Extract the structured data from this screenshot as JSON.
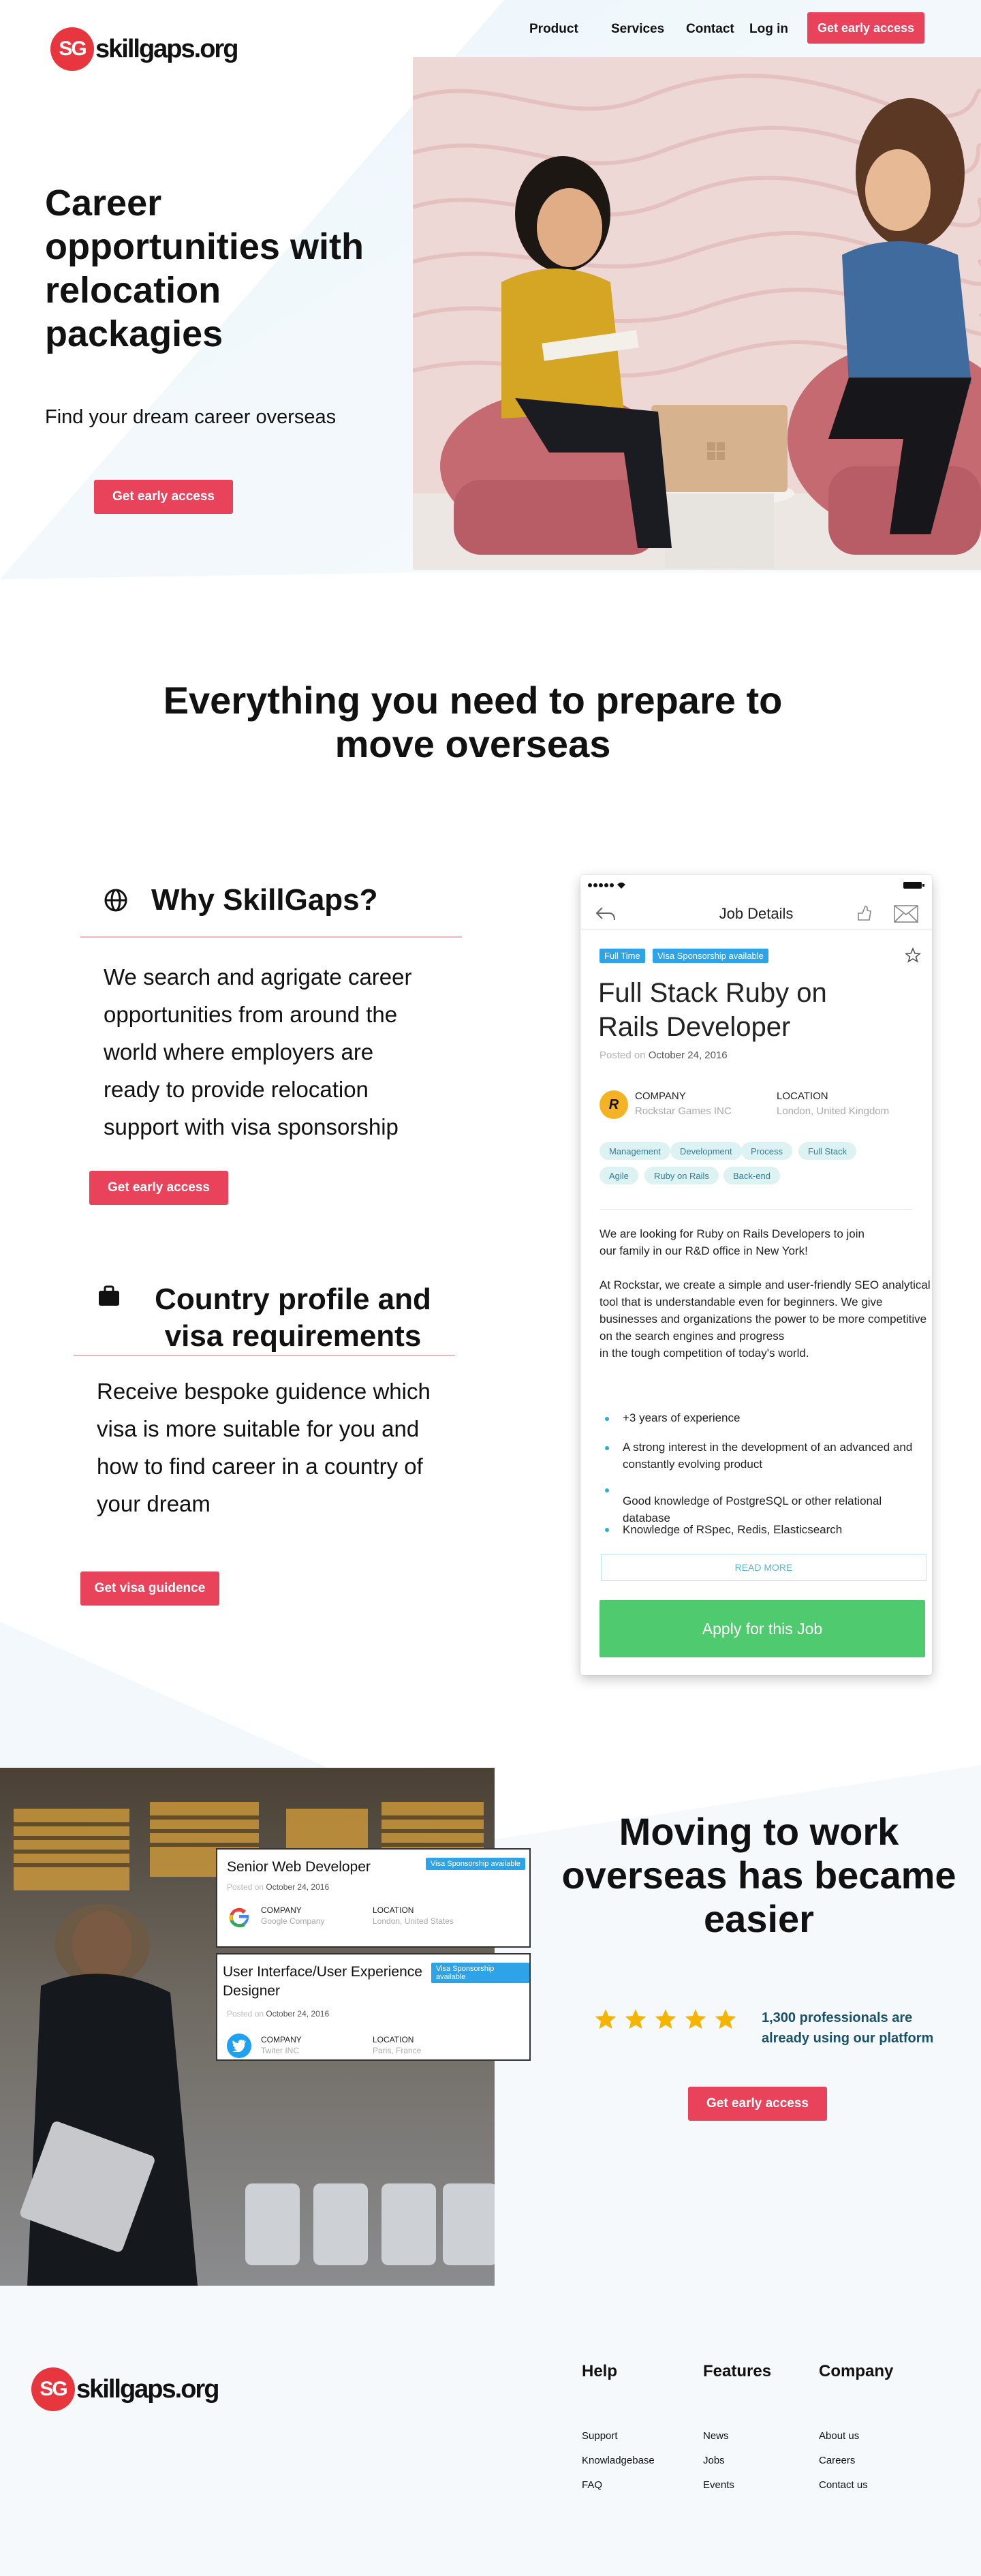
{
  "brand": {
    "badge": "SG",
    "name": "skillgaps.org"
  },
  "nav": {
    "product": "Product",
    "services": "Services",
    "contact": "Contact",
    "login": "Log in",
    "cta": "Get early access"
  },
  "hero": {
    "title_line1": "Career",
    "title_line2": "opportunities with",
    "title_line3": "relocation",
    "title_line4": "packagies",
    "subtitle": "Find your dream career overseas",
    "cta": "Get early access"
  },
  "features": {
    "title_line1": "Everything you need to prepare to",
    "title_line2": "move overseas",
    "why": {
      "icon": "globe-icon",
      "heading": "Why SkillGaps?",
      "body_lines": [
        "We search and agrigate career",
        "opportunities from around the",
        "world where employers are",
        "ready to provide relocation",
        "support with visa sponsorship"
      ],
      "cta": "Get early access"
    },
    "country": {
      "icon": "briefcase-icon",
      "heading_line1": "Country profile and",
      "heading_line2": "visa requirements",
      "body_lines": [
        "Receive bespoke guidence which",
        "visa is more suitable for you and",
        "how to find career in a country of",
        "your dream"
      ],
      "cta": "Get visa guidence"
    }
  },
  "job_details": {
    "screen_title": "Job Details",
    "tags": [
      "Full Time",
      "Visa Sponsorship available"
    ],
    "title_line1": "Full Stack Ruby on",
    "title_line2": "Rails Developer",
    "posted_label": "Posted on",
    "posted_date": "October 24, 2016",
    "company_label": "COMPANY",
    "company_value": "Rockstar Games INC",
    "location_label": "LOCATION",
    "location_value": "London, United Kingdom",
    "skills_row1": [
      "Management",
      "Development",
      "Process",
      "Full Stack"
    ],
    "skills_row2": [
      "Agile",
      "Ruby on Rails",
      "Back-end"
    ],
    "desc_lines": [
      "We are looking for Ruby on Rails Developers to join",
      "our family in our R&D office in New York!",
      "",
      "At Rockstar, we create a simple and user-friendly SEO analytical",
      "tool that is understandable even for beginners. We give",
      "businesses and organizations the power to be more competitive",
      "on the search engines and progress",
      "in the tough competition of today's world."
    ],
    "requirements": [
      "+3 years of experience",
      "A strong interest in the development of an advanced and",
      "constantly evolving product",
      "Good knowledge of PostgreSQL or other relational database",
      "Knowledge of RSpec, Redis, Elasticsearch"
    ],
    "read_more": "READ MORE",
    "apply": "Apply for this Job"
  },
  "moving": {
    "title_line1": "Moving to work",
    "title_line2": "overseas has became",
    "title_line3": "easier",
    "rating_count": 5,
    "social_proof_line1": "1,300 professionals  are",
    "social_proof_line2": "already using our platform",
    "cta": "Get early access",
    "card1": {
      "title": "Senior Web Developer",
      "tag": "Visa Sponsorship available",
      "posted_label": "Posted on",
      "posted_date": "October 24, 2016",
      "company_label": "COMPANY",
      "company_value": "Google Company",
      "location_label": "LOCATION",
      "location_value": "London, United States"
    },
    "card2": {
      "title_line1": "User Interface/User Experience",
      "title_line2": "Designer",
      "tag": "Visa Sponsorship available",
      "posted_label": "Posted on",
      "posted_date": "October 24, 2016",
      "company_label": "COMPANY",
      "company_value": "Twiter INC",
      "location_label": "LOCATION",
      "location_value": "Paris, France"
    }
  },
  "footer": {
    "help": {
      "heading": "Help",
      "links": [
        "Support",
        "Knowladgebase",
        "FAQ"
      ]
    },
    "features": {
      "heading": "Features",
      "links": [
        "News",
        "Jobs",
        "Events"
      ]
    },
    "company": {
      "heading": "Company",
      "links": [
        "About us",
        "Careers",
        "Contact us"
      ]
    }
  },
  "colors": {
    "accent": "#e8435a",
    "logo_red": "#e8363f",
    "apply_green": "#4fca6f",
    "tag_blue": "#2fa3e8",
    "star_yellow": "#f5b400",
    "proof_teal": "#19516a"
  }
}
